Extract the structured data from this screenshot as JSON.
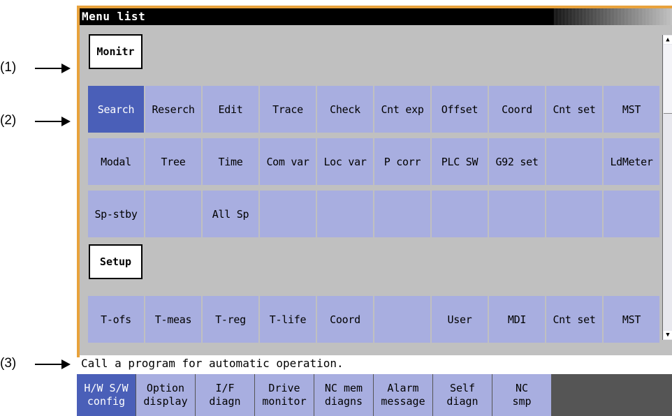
{
  "callouts": [
    "(1)",
    "(2)",
    "(3)"
  ],
  "window": {
    "title": "Menu list"
  },
  "sections": [
    {
      "label": "Monitr",
      "rows": [
        [
          "Search",
          "Reserch",
          "Edit",
          "Trace",
          "Check",
          "Cnt exp",
          "Offset",
          "Coord",
          "Cnt set",
          "MST"
        ],
        [
          "Modal",
          "Tree",
          "Time",
          "Com var",
          "Loc var",
          "P corr",
          "PLC SW",
          "G92 set",
          "",
          "LdMeter"
        ],
        [
          "Sp-stby",
          "",
          "All Sp",
          "",
          "",
          "",
          "",
          "",
          "",
          ""
        ]
      ]
    },
    {
      "label": "Setup",
      "rows": [
        [
          "T-ofs",
          "T-meas",
          "T-reg",
          "T-life",
          "Coord",
          "",
          "User",
          "MDI",
          "Cnt set",
          "MST"
        ]
      ]
    }
  ],
  "status_message": "Call a program for automatic operation.",
  "scrollbar": {
    "up": "▲",
    "down": "▼"
  },
  "menu_keys": [
    {
      "line1": "H/W S/W",
      "line2": "config"
    },
    {
      "line1": "Option",
      "line2": "display"
    },
    {
      "line1": "I/F",
      "line2": "diagn"
    },
    {
      "line1": "Drive",
      "line2": "monitor"
    },
    {
      "line1": "NC mem",
      "line2": "diagns"
    },
    {
      "line1": "Alarm",
      "line2": "message"
    },
    {
      "line1": "Self",
      "line2": "diagn"
    },
    {
      "line1": "NC",
      "line2": "smp"
    },
    {
      "line1": "",
      "line2": ""
    },
    {
      "line1": "",
      "line2": ""
    }
  ],
  "colors": {
    "frame": "#e8a23c",
    "key": "#a8aee0",
    "key_selected": "#4a5fb8",
    "background": "#c0c0c0"
  }
}
